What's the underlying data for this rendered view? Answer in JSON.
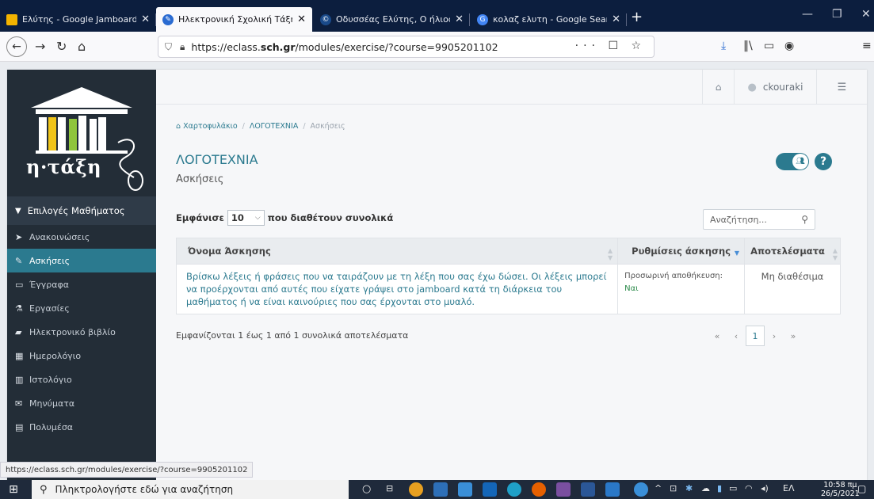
{
  "browser": {
    "tabs": [
      {
        "title": "Ελύτης - Google Jamboard",
        "icon": "jamboard-icon",
        "color": "#f4b400",
        "active": false
      },
      {
        "title": "Ηλεκτρονική Σχολική Τάξη (η-",
        "icon": "eclass-icon",
        "color": "#2a6bd1",
        "active": true
      },
      {
        "title": "Οδυσσέας Ελύτης, Ο ήλιος ο ηλ",
        "icon": "page-icon",
        "color": "#1a4a8a",
        "active": false
      },
      {
        "title": "κολαζ ελυτη - Google Search",
        "icon": "google-icon",
        "color": "#4285f4",
        "active": false
      }
    ],
    "url_prefix": "https://eclass.",
    "url_host": "sch.gr",
    "url_path": "/modules/exercise/?course=9905201102",
    "url_actions": "··· ☐ ☆",
    "status_url": "https://eclass.sch.gr/modules/exercise/?course=9905201102"
  },
  "sidebar": {
    "logo_text": "η·τάξη",
    "section_label": "Επιλογές Μαθήματος",
    "items": [
      {
        "label": "Ανακοινώσεις",
        "icon": "megaphone-icon",
        "glyph": "✉",
        "active": false
      },
      {
        "label": "Ασκήσεις",
        "icon": "edit-icon",
        "glyph": "✎",
        "active": true
      },
      {
        "label": "Έγγραφα",
        "icon": "folder-icon",
        "glyph": "▭",
        "active": false
      },
      {
        "label": "Εργασίες",
        "icon": "flask-icon",
        "glyph": "⚗",
        "active": false
      },
      {
        "label": "Ηλεκτρονικό βιβλίο",
        "icon": "book-icon",
        "glyph": "▰",
        "active": false
      },
      {
        "label": "Ημερολόγιο",
        "icon": "calendar-icon",
        "glyph": "▦",
        "active": false
      },
      {
        "label": "Ιστολόγιο",
        "icon": "blog-icon",
        "glyph": "▥",
        "active": false
      },
      {
        "label": "Μηνύματα",
        "icon": "envelope-icon",
        "glyph": "✉",
        "active": false
      },
      {
        "label": "Πολυμέσα",
        "icon": "film-icon",
        "glyph": "▤",
        "active": false
      }
    ]
  },
  "header": {
    "username": "ckouraki"
  },
  "breadcrumb": {
    "home": "Χαρτοφυλάκιο",
    "course": "ΛΟΓΟΤΕΧΝΙΑ",
    "current": "Ασκήσεις"
  },
  "page": {
    "course_title": "ΛΟΓΟΤΕΧΝΙΑ",
    "section_title": "Ασκήσεις"
  },
  "table_controls": {
    "show_label": "Εμφάνισε",
    "page_size": "10",
    "of_total_label": "που διαθέτουν συνολικά",
    "search_placeholder": "Αναζήτηση..."
  },
  "table": {
    "headers": [
      "Όνομα Άσκησης",
      "Ρυθμίσεις άσκησης",
      "Αποτελέσματα"
    ],
    "rows": [
      {
        "name": "Βρίσκω λέξεις ή φράσεις που να ταιράζουν με τη λέξη που σας έχω δώσει. Οι λέξεις μπορεί να προέρχονται από αυτές που είχατε γράψει στο jamboard κατά τη διάρκεια του μαθήματος ή να είναι καινούριες που σας έρχονται στο μυαλό.",
        "settings_label": "Προσωρινή αποθήκευση:",
        "settings_value": "Ναι",
        "results": "Μη διαθέσιμα"
      }
    ]
  },
  "pagination": {
    "info": "Εμφανίζονται 1 έως 1 από 1 συνολικά αποτελέσματα",
    "first": "«",
    "prev": "‹",
    "current": "1",
    "next": "›",
    "last": "»"
  },
  "taskbar": {
    "search_placeholder": "Πληκτρολογήστε εδώ για αναζήτηση",
    "language": "ΕΛ",
    "time": "10:58 πμ",
    "date": "26/5/2021"
  },
  "colors": {
    "accent": "#2b7a8f",
    "sidebar_bg": "#232d37",
    "tabstrip_bg": "#0c1e3e"
  }
}
